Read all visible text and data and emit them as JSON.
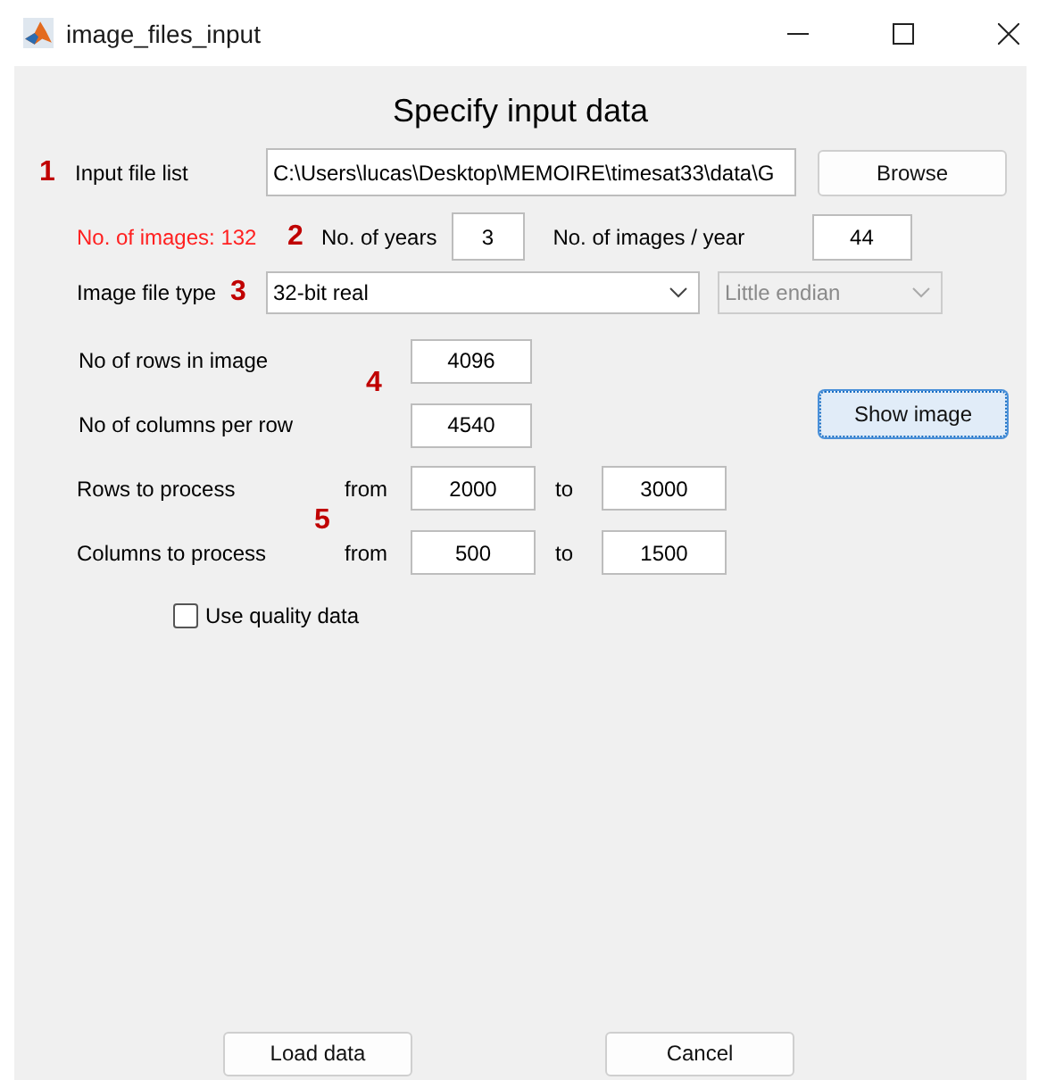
{
  "window": {
    "title": "image_files_input"
  },
  "heading": "Specify input data",
  "input_file": {
    "marker": "1",
    "label": "Input file list",
    "value": "C:\\Users\\lucas\\Desktop\\MEMOIRE\\timesat33\\data\\G",
    "button": "Browse"
  },
  "counts": {
    "images_label": "No. of images: 132",
    "marker": "2",
    "years_label": "No. of years",
    "years": "3",
    "per_year_label": "No. of images / year",
    "per_year": "44"
  },
  "file_type": {
    "label": "Image file type",
    "marker": "3",
    "type": "32-bit real",
    "byte_order": "Little endian",
    "byte_order_disabled": true
  },
  "dimensions": {
    "marker": "4",
    "rows_label": "No of rows in image",
    "rows": "4096",
    "cols_label": "No of columns per row",
    "cols": "4540",
    "button": "Show image",
    "button_focused": true
  },
  "ranges": {
    "marker": "5",
    "rows": [
      {
        "label": "Rows to process",
        "from_label": "from",
        "from": "2000",
        "to_label": "to",
        "to": "3000"
      },
      {
        "label": "Columns to process",
        "from_label": "from",
        "from": "500",
        "to_label": "to",
        "to": "1500"
      }
    ]
  },
  "quality": {
    "label": "Use quality data",
    "checked": false
  },
  "buttons": [
    "Load data",
    "Cancel"
  ]
}
